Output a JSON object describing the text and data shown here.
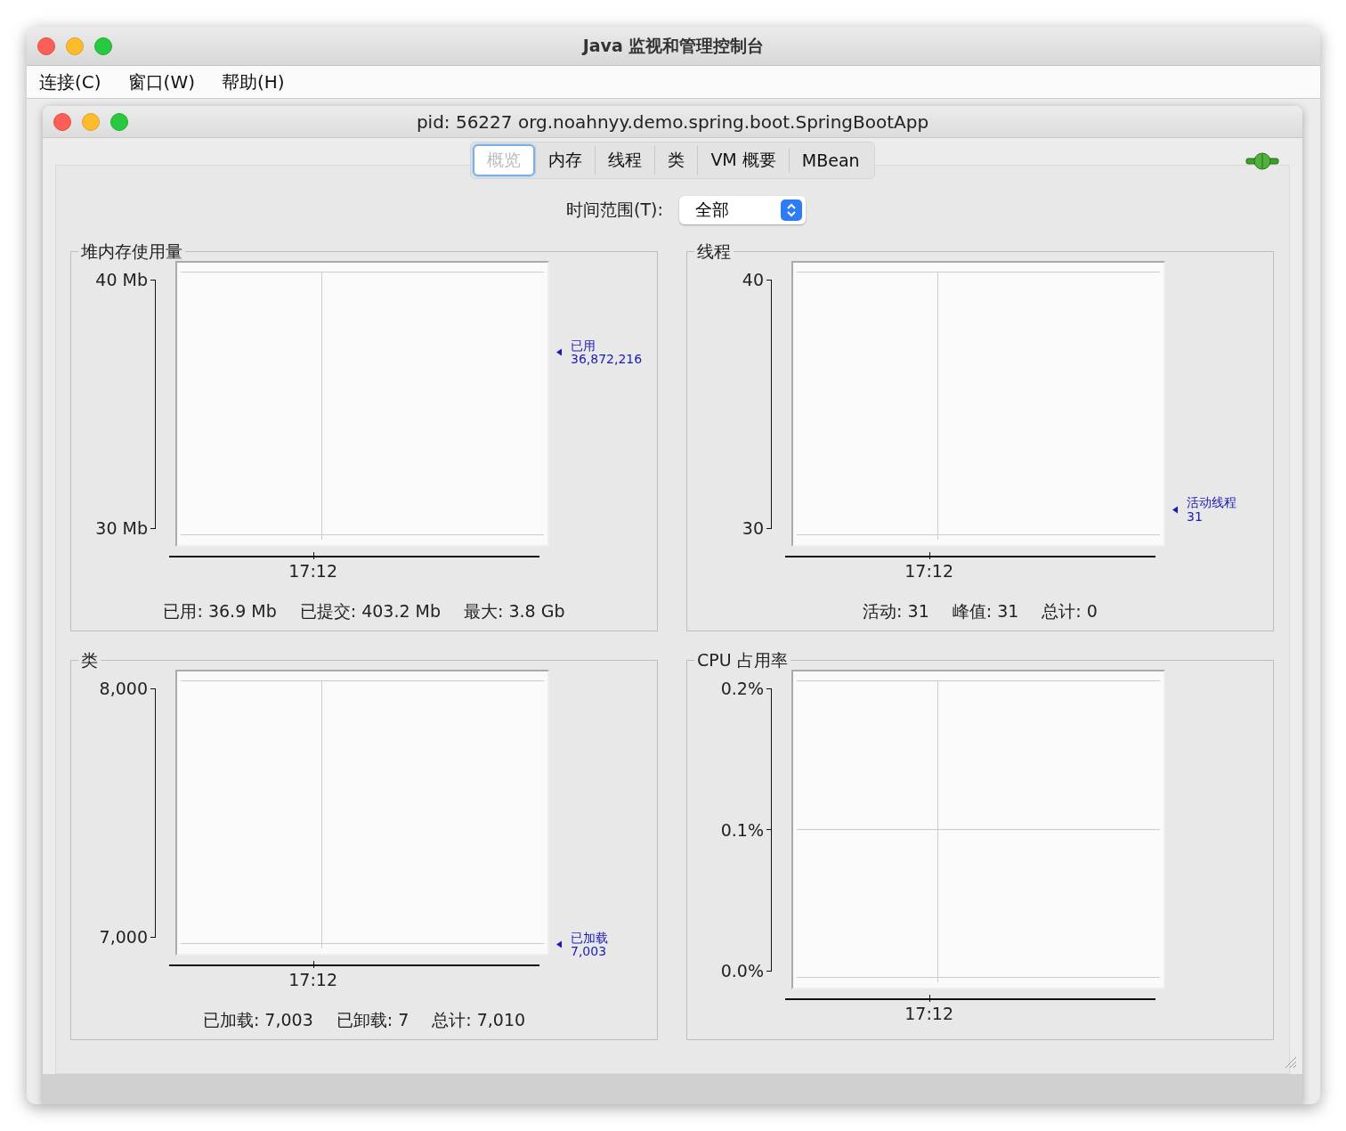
{
  "window": {
    "title": "Java 监视和管理控制台"
  },
  "menu": [
    "连接(C)",
    "窗口(W)",
    "帮助(H)"
  ],
  "inner_window": {
    "title": "pid: 56227 org.noahnyy.demo.spring.boot.SpringBootApp"
  },
  "tabs": [
    {
      "label": "概览",
      "selected": true
    },
    {
      "label": "内存",
      "selected": false
    },
    {
      "label": "线程",
      "selected": false
    },
    {
      "label": "类",
      "selected": false
    },
    {
      "label": "VM 概要",
      "selected": false
    },
    {
      "label": "MBean",
      "selected": false
    }
  ],
  "time_range": {
    "label": "时间范围(T):",
    "value": "全部"
  },
  "panels": [
    {
      "title": "堆内存使用量",
      "y_ticks": [
        "40 Mb",
        "30 Mb"
      ],
      "x_tick": "17:12",
      "legend": {
        "name": "已用",
        "value": "36,872,216"
      },
      "stats": [
        "已用: 36.9 Mb",
        "已提交: 403.2 Mb",
        "最大: 3.8 Gb"
      ]
    },
    {
      "title": "线程",
      "y_ticks": [
        "40",
        "30"
      ],
      "x_tick": "17:12",
      "legend": {
        "name": "活动线程",
        "value": "31"
      },
      "stats": [
        "活动: 31",
        "峰值: 31",
        "总计: 0"
      ]
    },
    {
      "title": "类",
      "y_ticks": [
        "8,000",
        "7,000"
      ],
      "x_tick": "17:12",
      "legend": {
        "name": "已加载",
        "value": "7,003"
      },
      "stats": [
        "已加载: 7,003",
        "已卸载: 7",
        "总计: 7,010"
      ]
    },
    {
      "title": "CPU 占用率",
      "y_ticks": [
        "0.2%",
        "0.1%",
        "0.0%"
      ],
      "x_tick": "17:12"
    }
  ]
}
